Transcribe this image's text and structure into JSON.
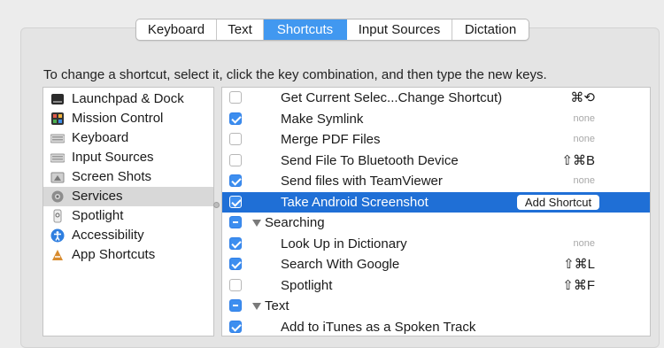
{
  "tabs": [
    {
      "label": "Keyboard",
      "selected": false
    },
    {
      "label": "Text",
      "selected": false
    },
    {
      "label": "Shortcuts",
      "selected": true
    },
    {
      "label": "Input Sources",
      "selected": false
    },
    {
      "label": "Dictation",
      "selected": false
    }
  ],
  "instructions": "To change a shortcut, select it, click the key combination, and then type the new keys.",
  "categories": [
    {
      "label": "Launchpad & Dock",
      "icon": "launchpad-dock-icon"
    },
    {
      "label": "Mission Control",
      "icon": "mission-control-icon"
    },
    {
      "label": "Keyboard",
      "icon": "keyboard-icon"
    },
    {
      "label": "Input Sources",
      "icon": "input-sources-icon"
    },
    {
      "label": "Screen Shots",
      "icon": "screenshot-icon"
    },
    {
      "label": "Services",
      "icon": "services-gear-icon",
      "selected": true
    },
    {
      "label": "Spotlight",
      "icon": "spotlight-icon"
    },
    {
      "label": "Accessibility",
      "icon": "accessibility-icon"
    },
    {
      "label": "App Shortcuts",
      "icon": "app-shortcuts-icon"
    }
  ],
  "shortcuts": [
    {
      "label": "Get Current Selec...Change Shortcut)",
      "checked": false,
      "key": "⌘⟲"
    },
    {
      "label": "Make Symlink",
      "checked": true,
      "key": "none"
    },
    {
      "label": "Merge PDF Files",
      "checked": false,
      "key": "none"
    },
    {
      "label": "Send File To Bluetooth Device",
      "checked": false,
      "key": "⇧⌘B"
    },
    {
      "label": "Send files with TeamViewer",
      "checked": true,
      "key": "none"
    },
    {
      "label": "Take Android Screenshot",
      "checked": true,
      "selected": true,
      "button": "Add Shortcut"
    },
    {
      "label": "Searching",
      "group": true,
      "checked": "mixed"
    },
    {
      "label": "Look Up in Dictionary",
      "checked": true,
      "key": "none"
    },
    {
      "label": "Search With Google",
      "checked": true,
      "key": "⇧⌘L"
    },
    {
      "label": "Spotlight",
      "checked": false,
      "key": "⇧⌘F"
    },
    {
      "label": "Text",
      "group": true,
      "checked": "mixed"
    },
    {
      "label": "Add to iTunes as a Spoken Track",
      "checked": true,
      "key": ""
    }
  ],
  "colors": {
    "accent": "#4198f0",
    "selection": "#1f6fd6",
    "checkbox": "#3d8eef"
  }
}
